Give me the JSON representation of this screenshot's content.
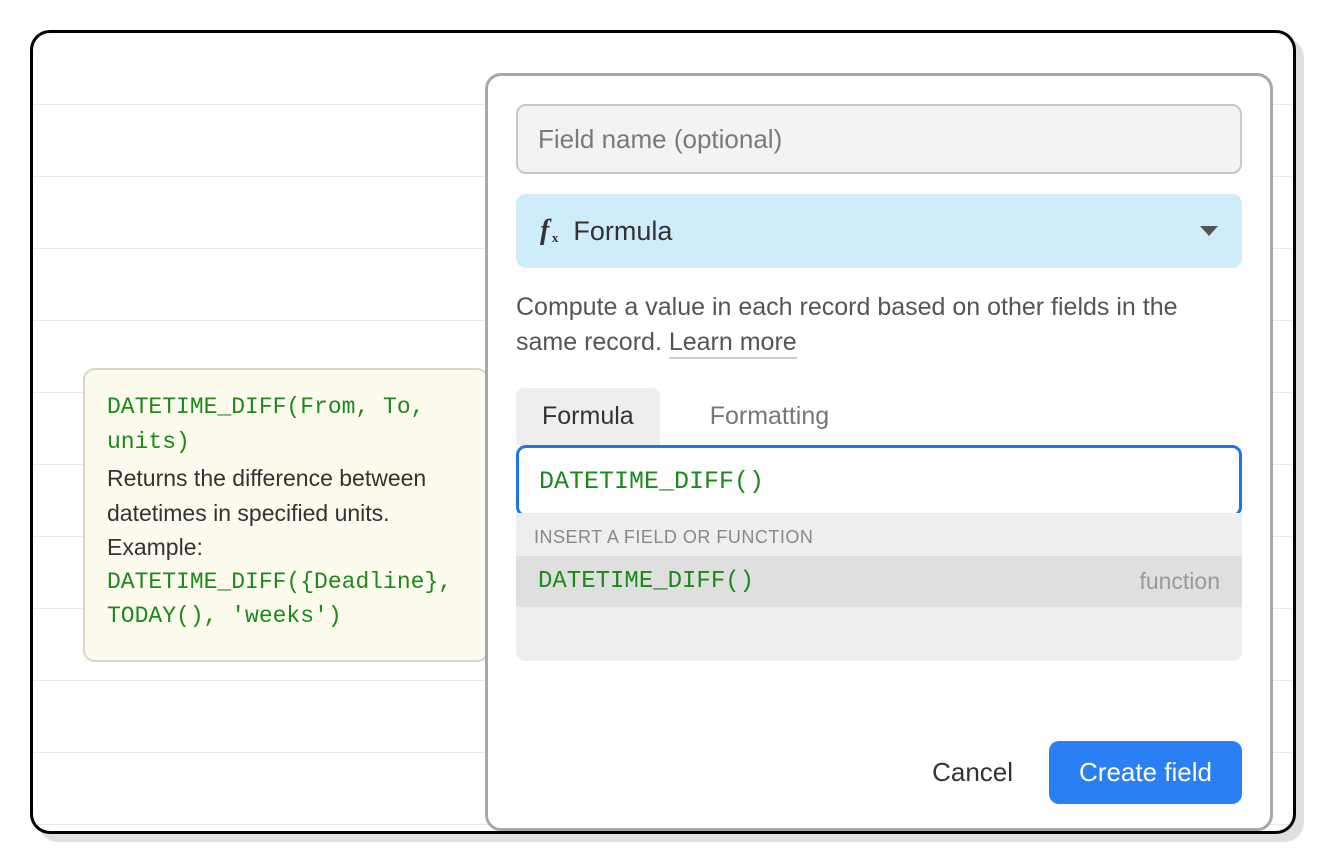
{
  "tooltip": {
    "signature": "DATETIME_DIFF(From, To, units)",
    "description": "Returns the difference between datetimes in specified units. Example:",
    "example": "DATETIME_DIFF({Deadline}, TODAY(), 'weeks')"
  },
  "panel": {
    "field_name_placeholder": "Field name (optional)",
    "type_label": "Formula",
    "description_text": "Compute a value in each record based on other fields in the same record. ",
    "learn_more": "Learn more",
    "tabs": {
      "formula": "Formula",
      "formatting": "Formatting"
    },
    "formula_value": "DATETIME_DIFF()",
    "autocomplete": {
      "header": "INSERT A FIELD OR FUNCTION",
      "items": [
        {
          "name": "DATETIME_DIFF()",
          "kind": "function"
        }
      ]
    },
    "footer": {
      "cancel": "Cancel",
      "create": "Create field"
    }
  }
}
